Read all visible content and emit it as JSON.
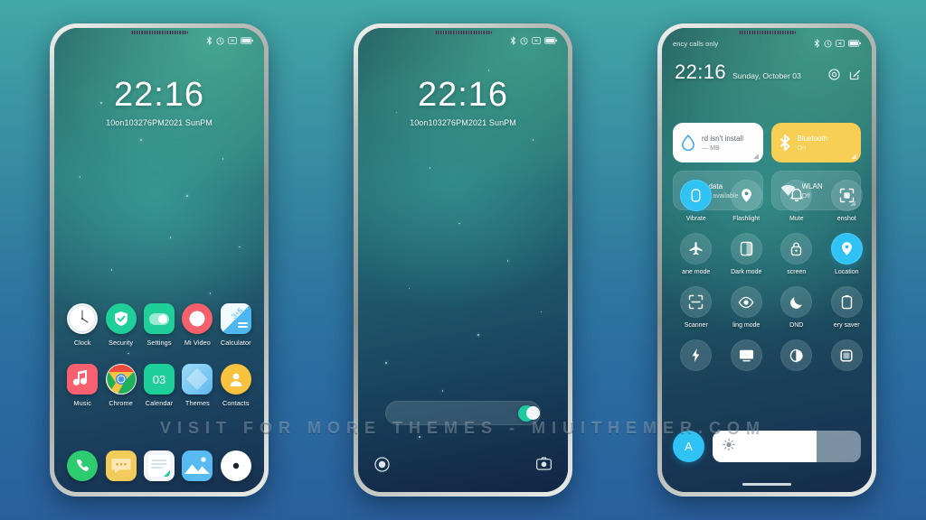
{
  "watermark": {
    "text": "VISIT FOR MORE THEMES - MIUITHEMER.COM"
  },
  "theme": {
    "accent_cyan": "#2fc2f5",
    "accent_amber": "#f7cf55",
    "accent_green": "#1fc9a0",
    "background_top": "#42a8a5",
    "background_bottom": "#2a5f9c"
  },
  "phone1": {
    "name": "homescreen",
    "statusbar": {
      "left_text": "",
      "icons": [
        "bluetooth-icon",
        "alarm-icon",
        "vibrate-icon",
        "battery-icon"
      ]
    },
    "clock": {
      "time": "22:16",
      "date": "10on103276PM2021 SunPM"
    },
    "apps_row1": [
      {
        "label": "Clock",
        "icon": "clock-icon"
      },
      {
        "label": "Security",
        "icon": "shield-check-icon"
      },
      {
        "label": "Settings",
        "icon": "settings-toggle-icon"
      },
      {
        "label": "Mi Video",
        "icon": "video-record-icon"
      },
      {
        "label": "Calculator",
        "icon": "calculator-icon"
      }
    ],
    "apps_row2": [
      {
        "label": "Music",
        "icon": "music-note-icon"
      },
      {
        "label": "Chrome",
        "icon": "chrome-icon"
      },
      {
        "label": "Calendar",
        "icon": "calendar-icon",
        "day": "03"
      },
      {
        "label": "Themes",
        "icon": "themes-icon"
      },
      {
        "label": "Contacts",
        "icon": "contacts-person-icon"
      }
    ],
    "dock": [
      {
        "label": "Phone",
        "icon": "phone-handset-icon"
      },
      {
        "label": "Messages",
        "icon": "message-bubble-icon"
      },
      {
        "label": "Notes",
        "icon": "notes-icon"
      },
      {
        "label": "Gallery",
        "icon": "gallery-photo-icon"
      },
      {
        "label": "Browser",
        "icon": "browser-disc-icon"
      }
    ]
  },
  "phone2": {
    "name": "lockscreen",
    "statusbar": {
      "left_text": "",
      "icons": [
        "bluetooth-icon",
        "alarm-icon",
        "vibrate-icon",
        "battery-icon"
      ]
    },
    "clock": {
      "time": "22:16",
      "date": "10on103276PM2021 SunPM"
    },
    "unlock_slider": {
      "label": "",
      "knob_position_pct": 88
    },
    "shortcuts": [
      {
        "label": "Torch",
        "icon": "torch-circle-icon"
      },
      {
        "label": "Camera",
        "icon": "camera-icon"
      }
    ]
  },
  "phone3": {
    "name": "control-center",
    "statusbar": {
      "left_text": "ency calls only",
      "icons": [
        "bluetooth-icon",
        "alarm-icon",
        "vibrate-icon",
        "battery-icon"
      ]
    },
    "header": {
      "time": "22:16",
      "date": "Sunday, October 03",
      "icons": [
        "settings-gear-icon",
        "edit-pencil-icon"
      ]
    },
    "big_tiles": [
      {
        "title": "rd isn't install",
        "sub": "— MB",
        "icon": "water-drop-icon",
        "state": "white"
      },
      {
        "title": "Bluetooth",
        "sub": "On",
        "icon": "bluetooth-icon",
        "state": "amber"
      },
      {
        "title": "le data",
        "sub": "Not available",
        "icon": "mobile-data-icon",
        "state": "glass"
      },
      {
        "title": "WLAN",
        "sub": "Off",
        "icon": "wifi-icon",
        "state": "glass"
      }
    ],
    "toggles": [
      {
        "label": "Vibrate",
        "icon": "vibrate-icon",
        "on": true
      },
      {
        "label": "Flashlight",
        "icon": "flashlight-icon",
        "on": false
      },
      {
        "label": "Mute",
        "icon": "bell-icon",
        "on": false
      },
      {
        "label": "enshot",
        "icon": "screenshot-icon",
        "on": false
      },
      {
        "label": "ane mode",
        "icon": "airplane-icon",
        "on": false
      },
      {
        "label": "Dark mode",
        "icon": "dark-mode-icon",
        "on": false
      },
      {
        "label": "screen",
        "icon": "lock-screen-icon",
        "on": false
      },
      {
        "label": "Location",
        "icon": "location-pin-icon",
        "on": true
      },
      {
        "label": "Scanner",
        "icon": "scanner-icon",
        "on": false
      },
      {
        "label": "ling mode",
        "icon": "reading-eye-icon",
        "on": false
      },
      {
        "label": "DND",
        "icon": "moon-icon",
        "on": false
      },
      {
        "label": "ery saver",
        "icon": "battery-saver-icon",
        "on": false
      },
      {
        "label": "",
        "icon": "lightning-icon",
        "on": false
      },
      {
        "label": "",
        "icon": "cast-screen-icon",
        "on": false
      },
      {
        "label": "",
        "icon": "night-light-icon",
        "on": false
      },
      {
        "label": "",
        "icon": "rotate-screen-icon",
        "on": false
      }
    ],
    "brightness": {
      "auto_label": "A",
      "level_pct": 70,
      "icon": "brightness-sun-icon"
    }
  }
}
